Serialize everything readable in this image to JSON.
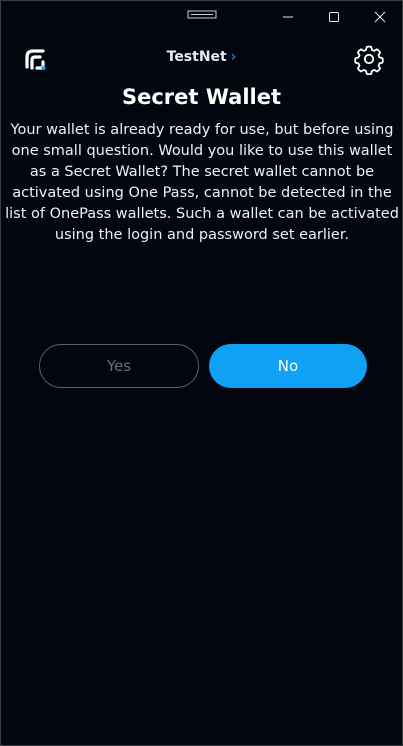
{
  "window": {
    "controls": {
      "minimize_icon": "minimize-icon",
      "maximize_icon": "maximize-icon",
      "close_icon": "close-icon"
    }
  },
  "header": {
    "logo_icon": "app-logo-icon",
    "network_label": "TestNet",
    "network_chevron": "›",
    "settings_icon": "gear-icon"
  },
  "main": {
    "title": "Secret Wallet",
    "description": "Your wallet is already ready for use, but before using one small question. Would you like to use this wallet as a Secret Wallet? The secret wallet cannot be activated using One Pass, cannot be detected in the list of OnePass wallets. Such a wallet can be activated using the login and password set earlier.",
    "yes_label": "Yes",
    "no_label": "No"
  },
  "colors": {
    "background": "#02070f",
    "accent": "#0ea1f4",
    "text": "#ffffff",
    "disabled_text": "#6a6f76"
  }
}
